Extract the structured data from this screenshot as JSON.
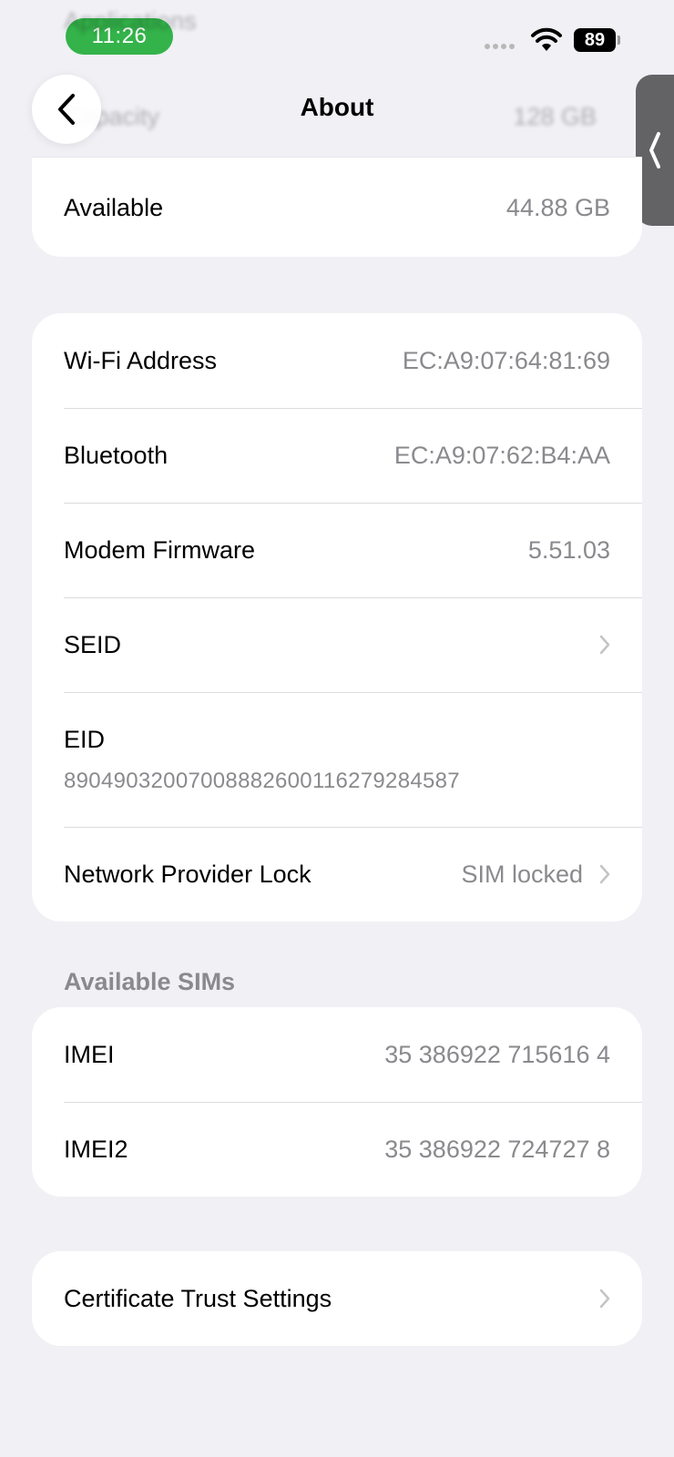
{
  "status_bar": {
    "time": "11:26",
    "battery": "89"
  },
  "nav": {
    "title": "About"
  },
  "ghosts": {
    "top_row_label": "Applications",
    "capacity_label": "Capacity",
    "capacity_value": "128 GB"
  },
  "storage": {
    "available_label": "Available",
    "available_value": "44.88 GB"
  },
  "network": {
    "rows": [
      {
        "label": "Wi-Fi Address",
        "value": "EC:A9:07:64:81:69"
      },
      {
        "label": "Bluetooth",
        "value": "EC:A9:07:62:B4:AA"
      },
      {
        "label": "Modem Firmware",
        "value": "5.51.03"
      },
      {
        "label": "SEID"
      },
      {
        "label": "EID",
        "value": "89049032007008882600116279284587"
      },
      {
        "label": "Network Provider Lock",
        "value": "SIM locked"
      }
    ]
  },
  "sims": {
    "header": "Available SIMs",
    "rows": [
      {
        "label": "IMEI",
        "value": "35 386922 715616 4"
      },
      {
        "label": "IMEI2",
        "value": "35 386922 724727 8"
      }
    ]
  },
  "certificates": {
    "label": "Certificate Trust Settings"
  }
}
